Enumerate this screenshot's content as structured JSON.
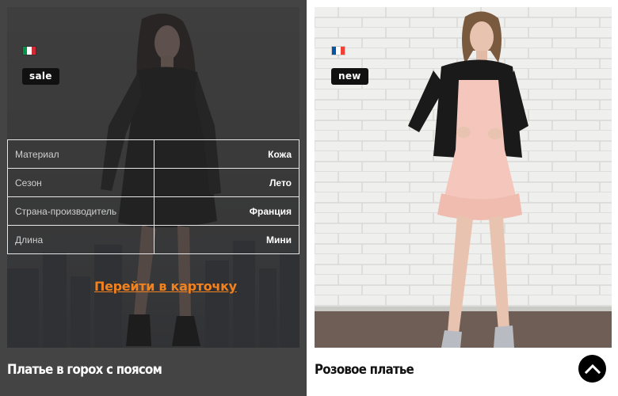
{
  "products": [
    {
      "flag_icon": "italy-flag-icon",
      "flag_colors": [
        "#009246",
        "#ffffff",
        "#ce2b37"
      ],
      "badge": "sale",
      "specs": [
        {
          "label": "Материал",
          "value": "Кожа"
        },
        {
          "label": "Сезон",
          "value": "Лето"
        },
        {
          "label": "Страна-производитель",
          "value": "Франция"
        },
        {
          "label": "Длина",
          "value": "Мини"
        }
      ],
      "link_text": "Перейти в карточку",
      "title": "Платье в горох с поясом"
    },
    {
      "flag_icon": "france-flag-icon",
      "flag_colors": [
        "#0055a4",
        "#ffffff",
        "#ef4135"
      ],
      "badge": "new",
      "title": "Розовое платье"
    }
  ],
  "scroll_top_icon": "chevron-up-icon",
  "colors": {
    "accent": "#f2821e",
    "card_hover_bg": "#444444",
    "badge_bg": "#111111"
  }
}
